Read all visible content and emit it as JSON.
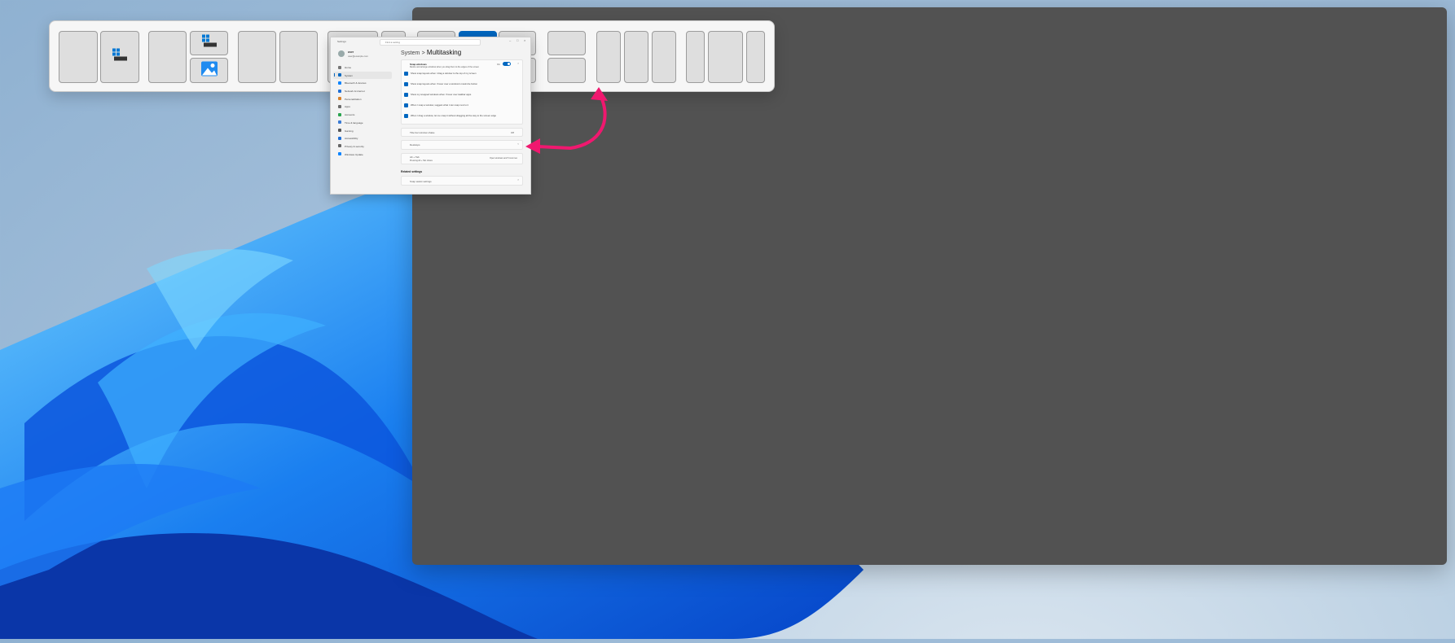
{
  "colors": {
    "accent": "#0067c0",
    "arrow": "#f0186f",
    "preview": "#525252",
    "flyout_bg": "#f6f6f6",
    "zone": "#dedede"
  },
  "snap_layouts": {
    "groups": [
      {
        "name": "half-half",
        "zones": 2
      },
      {
        "name": "main-plus-stack",
        "zones": 3
      },
      {
        "name": "two-equal",
        "zones": 2
      },
      {
        "name": "wide-narrow",
        "zones": 2
      },
      {
        "name": "quad",
        "zones": 4
      },
      {
        "name": "three-column",
        "zones": 3
      },
      {
        "name": "narrow-wide-narrow",
        "zones": 3
      }
    ],
    "highlighted_zone": "top-right-of-four-zone-layout"
  },
  "settings_window": {
    "title": "Settings",
    "search_placeholder": "Find a setting",
    "user_name": "user",
    "user_email": "user@example.com",
    "nav_items": [
      {
        "label": "Home",
        "icon": "home-icon",
        "color": "#777777"
      },
      {
        "label": "System",
        "icon": "monitor-icon",
        "color": "#0067c0",
        "selected": true
      },
      {
        "label": "Bluetooth & devices",
        "icon": "bluetooth-icon",
        "color": "#0a84ff"
      },
      {
        "label": "Network & internet",
        "icon": "wifi-icon",
        "color": "#1f6fd6"
      },
      {
        "label": "Personalization",
        "icon": "brush-icon",
        "color": "#d9822b"
      },
      {
        "label": "Apps",
        "icon": "apps-icon",
        "color": "#6b6b6b"
      },
      {
        "label": "Accounts",
        "icon": "person-icon",
        "color": "#2aa44f"
      },
      {
        "label": "Time & language",
        "icon": "globe-icon",
        "color": "#3a7bd5"
      },
      {
        "label": "Gaming",
        "icon": "gamepad-icon",
        "color": "#555555"
      },
      {
        "label": "Accessibility",
        "icon": "accessibility-icon",
        "color": "#1f6fd6"
      },
      {
        "label": "Privacy & security",
        "icon": "shield-icon",
        "color": "#666666"
      },
      {
        "label": "Windows Update",
        "icon": "update-icon",
        "color": "#0a84ff"
      }
    ],
    "breadcrumb_parent": "System",
    "breadcrumb_sep": ">",
    "page_title": "Multitasking",
    "snap_windows": {
      "title": "Snap windows",
      "desc": "Resize and arrange windows when you drag them to the edges of the screen",
      "state": "On"
    },
    "options": [
      "Show snap layouts when I drag a window to the top of my screen",
      "Show snap layouts when I hover over a window's maximize button",
      "Show my snapped windows when I hover over taskbar apps",
      "When I snap a window, suggest what I can snap next to it",
      "When I drag a window, let me snap it without dragging all the way to the screen edge"
    ],
    "title_shake": {
      "label": "Title bar window shake",
      "value": "Off"
    },
    "desktops": {
      "label": "Desktops"
    },
    "alt_tab": {
      "label": "Alt + Tab",
      "desc": "Pressing Alt + Tab shows",
      "value": "Open windows and 5 most recent tabs"
    },
    "related_label": "Related settings",
    "related_item": "Snap assist settings"
  }
}
